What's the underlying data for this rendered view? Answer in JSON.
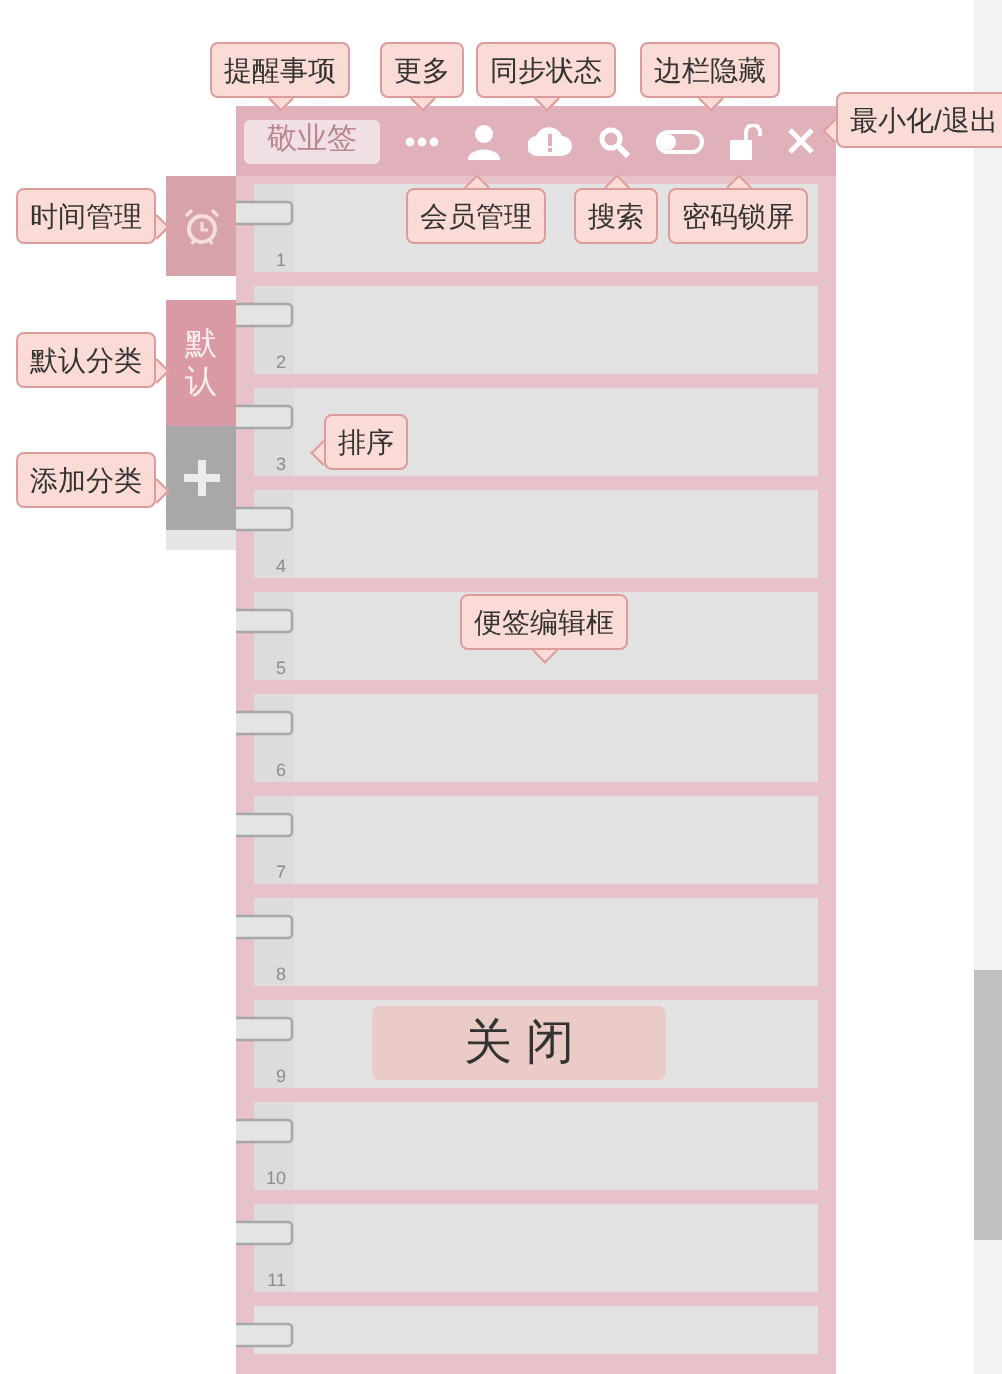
{
  "app": {
    "title": "敬业签"
  },
  "sidebar": [
    {
      "kind": "alarm"
    },
    {
      "kind": "category",
      "label": "默认"
    },
    {
      "kind": "add"
    }
  ],
  "notes": [
    "1",
    "2",
    "3",
    "4",
    "5",
    "6",
    "7",
    "8",
    "9",
    "10",
    "11"
  ],
  "close_button": "关 闭",
  "callouts": [
    "提醒事项",
    "更多",
    "同步状态",
    "边栏隐藏",
    "最小化/退出",
    "时间管理",
    "会员管理",
    "搜索",
    "密码锁屏",
    "默认分类",
    "添加分类",
    "排序",
    "便签编辑框"
  ]
}
